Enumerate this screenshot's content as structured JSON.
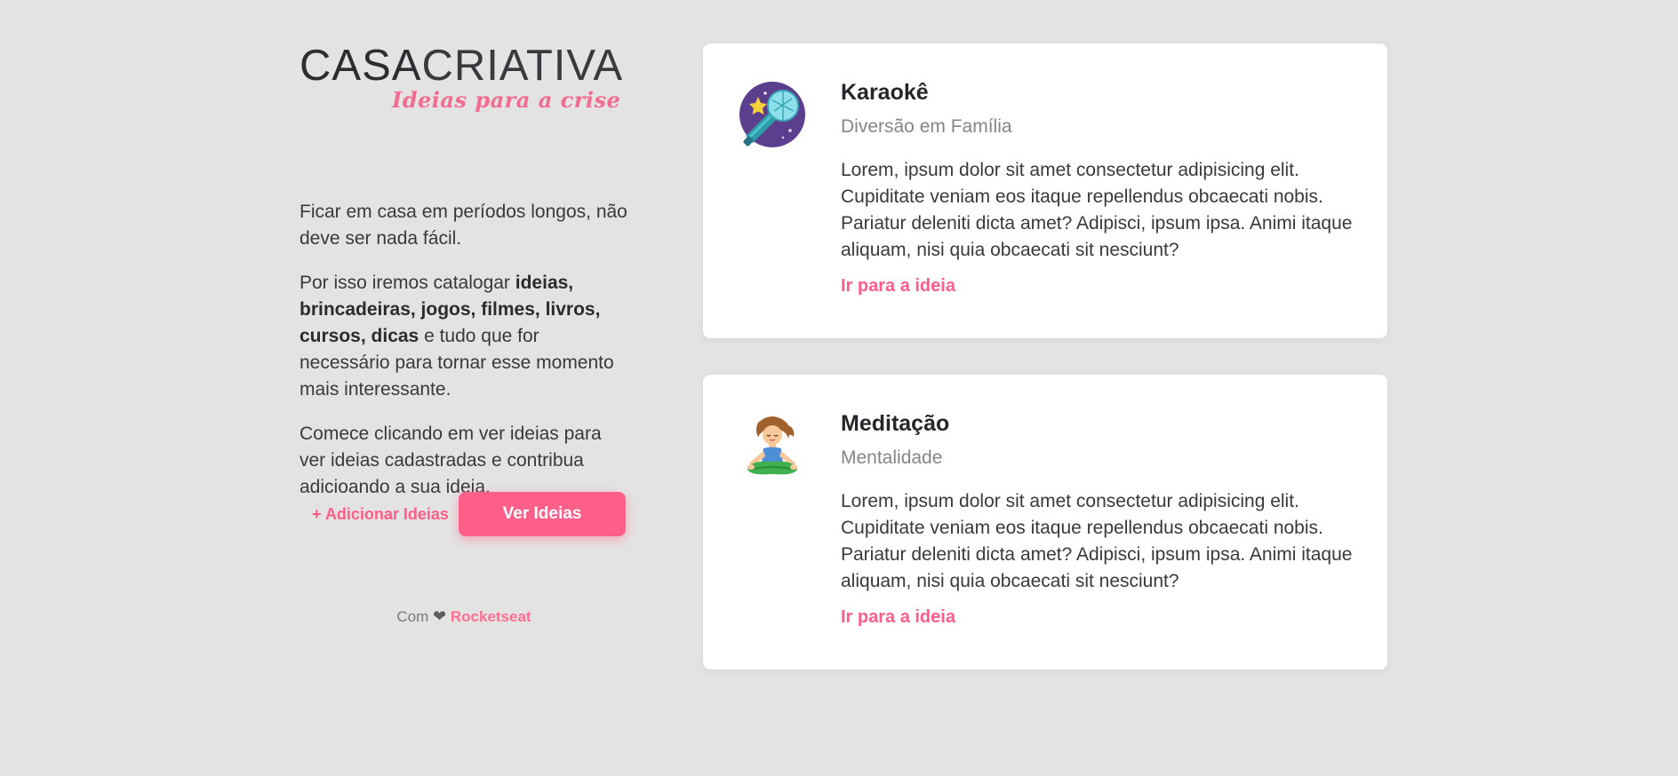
{
  "logo": {
    "main_bold": "CASA",
    "main_thin": "CRIATIVA",
    "tagline": "Ideias para a crise"
  },
  "intro": {
    "p1": "Ficar em casa em períodos longos, não deve ser nada fácil.",
    "p2_start": "Por isso iremos catalogar ",
    "p2_bold": "ideias, brincadeiras, jogos, filmes, livros, cursos, dicas",
    "p2_end": " e tudo que for necessário para tornar esse momento mais interessante.",
    "p3": "Comece clicando em ver ideias para ver ideias cadastradas e contribua adicioando a sua ideia."
  },
  "actions": {
    "add_label": "+ Adicionar Ideias",
    "view_label": "Ver Ideias"
  },
  "footer": {
    "prefix": "Com",
    "heart": "❤",
    "brand": "Rocketseat"
  },
  "ideas": [
    {
      "title": "Karaokê",
      "category": "Diversão em Família",
      "description": "Lorem, ipsum dolor sit amet consectetur adipisicing elit. Cupiditate veniam eos itaque repellendus obcaecati nobis. Pariatur deleniti dicta amet? Adipisci, ipsum ipsa. Animi itaque aliquam, nisi quia obcaecati sit nesciunt?",
      "link": "Ir para a ideia",
      "icon": "microphone-icon"
    },
    {
      "title": "Meditação",
      "category": "Mentalidade",
      "description": "Lorem, ipsum dolor sit amet consectetur adipisicing elit. Cupiditate veniam eos itaque repellendus obcaecati nobis. Pariatur deleniti dicta amet? Adipisci, ipsum ipsa. Animi itaque aliquam, nisi quia obcaecati sit nesciunt?",
      "link": "Ir para a ideia",
      "icon": "meditation-icon"
    }
  ],
  "colors": {
    "background": "#e4e3e3",
    "accent": "#ff5f88",
    "text": "#36343a",
    "muted": "#86848a"
  }
}
